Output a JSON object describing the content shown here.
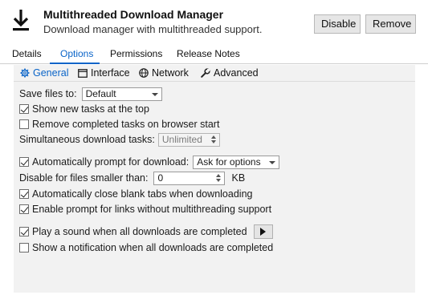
{
  "header": {
    "title": "Multithreaded Download Manager",
    "subtitle": "Download manager with multithreaded support.",
    "disable_label": "Disable",
    "remove_label": "Remove",
    "icon": "download-arrow-icon"
  },
  "tabs": [
    {
      "label": "Details"
    },
    {
      "label": "Options"
    },
    {
      "label": "Permissions"
    },
    {
      "label": "Release Notes"
    }
  ],
  "active_tab": "Options",
  "subtabs": [
    {
      "label": "General",
      "icon": "gear-icon"
    },
    {
      "label": "Interface",
      "icon": "window-icon"
    },
    {
      "label": "Network",
      "icon": "globe-icon"
    },
    {
      "label": "Advanced",
      "icon": "wrench-icon"
    }
  ],
  "active_subtab": "General",
  "options": {
    "save_files_label": "Save files to:",
    "save_files_value": "Default",
    "show_new_tasks": {
      "label": "Show new tasks at the top",
      "checked": true
    },
    "remove_completed": {
      "label": "Remove completed tasks on browser start",
      "checked": false
    },
    "simultaneous_label": "Simultaneous download tasks:",
    "simultaneous_value": "Unlimited",
    "auto_prompt": {
      "label": "Automatically prompt for download:",
      "checked": true
    },
    "auto_prompt_value": "Ask for options",
    "disable_smaller_label": "Disable for files smaller than:",
    "disable_smaller_value": "0",
    "disable_smaller_unit": "KB",
    "auto_close_tabs": {
      "label": "Automatically close blank tabs when downloading",
      "checked": true
    },
    "enable_prompt_links": {
      "label": "Enable prompt for links without multithreading support",
      "checked": true
    },
    "play_sound": {
      "label": "Play a sound when all downloads are completed",
      "checked": true
    },
    "show_notification": {
      "label": "Show a notification when all downloads are completed",
      "checked": false
    }
  },
  "colors": {
    "accent": "#0a64c8",
    "panel_bg": "#f2f2f2"
  }
}
